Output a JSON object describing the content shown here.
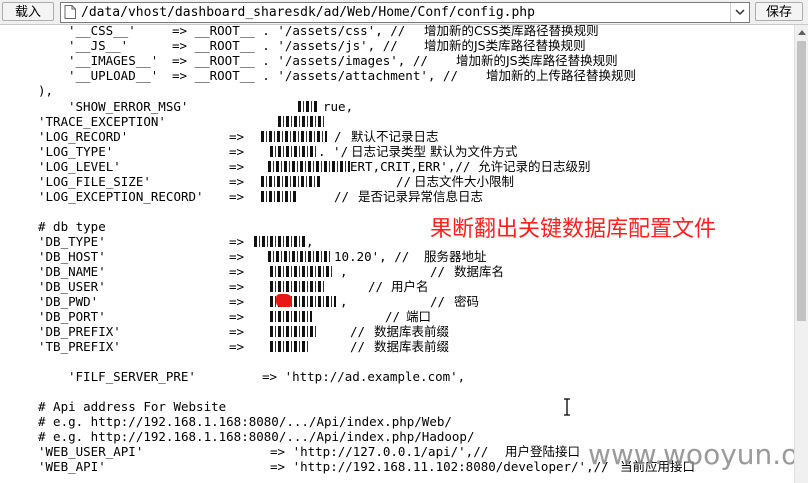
{
  "toolbar": {
    "load_label": "载入",
    "path_value": "/data/vhost/dashboard_sharesdk/ad/Web/Home/Conf/config.php",
    "save_label": "保存",
    "dropdown_icon": "chevron-down-icon",
    "file_icon": "file-icon"
  },
  "code": {
    "l1a": "'__CSS__'",
    "l1b": "=> __ROOT__ . '/assets/css', //",
    "l1c": "增加新的CSS类库路径替换规则",
    "l2a": "'__JS__'",
    "l2b": "=> __ROOT__ . '/assets/js', //",
    "l2c": "增加新的JS类库路径替换规则",
    "l3a": "'__IMAGES__'",
    "l3b": "=> __ROOT__ . '/assets/images', //",
    "l3c": "增加新的JS类库路径替换规则",
    "l4a": "'__UPLOAD__'",
    "l4b": "=> __ROOT__ . '/assets/attachment', //",
    "l4c": "增加新的上传路径替换规则",
    "l5": "),",
    "l6a": "'SHOW_ERROR_MSG'",
    "l6b": "rue,",
    "l7a": "'TRACE_EXCEPTION'",
    "l8a": "'LOG_RECORD'",
    "l8b": "=>",
    "l8c": "/",
    "l8d": "默认不记录日志",
    "l9a": "'LOG_TYPE'",
    "l9b": "=>",
    "l9c": ". '/",
    "l9d": "日志记录类型 默认为文件方式",
    "l10a": "'LOG_LEVEL'",
    "l10b": "=>",
    "l10c": "ERT,CRIT,ERR',//",
    "l10d": "允许记录的日志级别",
    "l11a": "'LOG_FILE_SIZE'",
    "l11b": "=>",
    "l11c": "//",
    "l11d": "日志文件大小限制",
    "l12a": "'LOG_EXCEPTION_RECORD'",
    "l12b": "=>",
    "l12c": "//",
    "l12d": "是否记录异常信息日志",
    "l13": "# db type",
    "l14a": "'DB_TYPE'",
    "l14b": "=>",
    "l14c": ",",
    "l15a": "'DB_HOST'",
    "l15b": "=>",
    "l15c": "10.20', //",
    "l15d": "服务器地址",
    "l16a": "'DB_NAME'",
    "l16b": "=>",
    "l16c": ",",
    "l16d": "//",
    "l16e": "数据库名",
    "l17a": "'DB_USER'",
    "l17b": "=>",
    "l17c": "//",
    "l17d": "用户名",
    "l18a": "'DB_PWD'",
    "l18b": "=>",
    "l18c": ",",
    "l18d": "//",
    "l18e": "密码",
    "l19a": "'DB_PORT'",
    "l19b": "=>",
    "l19c": "//",
    "l19d": "端口",
    "l20a": "'DB_PREFIX'",
    "l20b": "=>",
    "l20c": "//",
    "l20d": "数据库表前缀",
    "l21a": "'TB_PREFIX'",
    "l21b": "=>",
    "l21c": "//",
    "l21d": "数据库表前缀",
    "l22a": "'FILF_SERVER_PRE'",
    "l22b": "=> 'http://ad.example.com',",
    "l23": "# Api address For Website",
    "l24": "# e.g. http://192.168.1.168:8080/.../Api/index.php/Web/",
    "l25": "# e.g. http://192.168.1.168:8080/.../Api/index.php/Hadoop/",
    "l26a": "'WEB_USER_API'",
    "l26b": "=> 'http://127.0.0.1/api/',//",
    "l26c": "用户登陆接口",
    "l27a": "'WEB_API'",
    "l27b": "=> 'http://192.168.11.102:8080/developer/',//",
    "l27c": "当前应用接口"
  },
  "annotation": "果断翻出关键数据库配置文件",
  "watermark": "www.wooyun.org",
  "colors": {
    "annotation": "#ff2020",
    "redaction_mark": "#e81818",
    "toolbar_bg": "#f0f0f0"
  }
}
